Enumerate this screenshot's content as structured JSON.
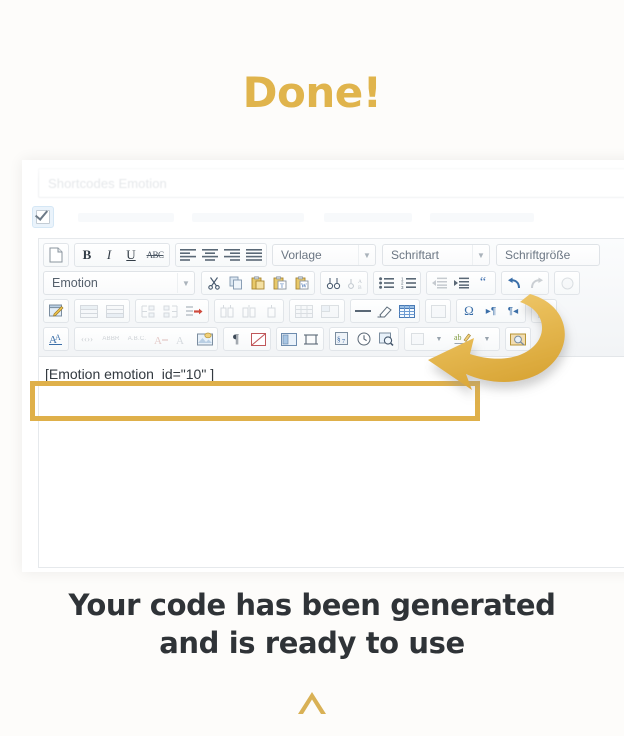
{
  "headline": "Done!",
  "colors": {
    "accent_gold": "#e0b44c",
    "highlight_box": "#dfb04a",
    "caption_text": "#2f3337",
    "page_background": "#fdfcfa"
  },
  "editor_panel": {
    "title_field": {
      "placeholder": "Shortcodes Emotion",
      "value": ""
    },
    "checkbox": {
      "checked": true,
      "label": ""
    },
    "toolbar": {
      "row1": {
        "buttons": [
          "new-document",
          "bold",
          "italic",
          "underline",
          "strikethrough",
          "align-left",
          "align-center",
          "align-right",
          "align-justify"
        ],
        "selects": [
          {
            "name": "template",
            "value": "Vorlage"
          },
          {
            "name": "font-family",
            "value": "Schriftart"
          },
          {
            "name": "font-size",
            "value": "Schriftgröße"
          }
        ]
      },
      "row2": {
        "select": {
          "name": "shortcode-style",
          "value": "Emotion"
        },
        "buttons": [
          "cut",
          "copy",
          "paste",
          "paste-as-text",
          "paste-from-word",
          "find",
          "find-and-replace",
          "bullet-list",
          "numbered-list",
          "outdent",
          "indent",
          "blockquote",
          "undo",
          "redo"
        ]
      },
      "row3": {
        "buttons": [
          "edit-html",
          "insert-row-before",
          "insert-row-after",
          "split-cell",
          "merge-cell",
          "delete-row",
          "insert-column-before",
          "insert-column-after",
          "delete-column",
          "table-row-properties",
          "table-cell-properties",
          "horizontal-rule",
          "remove-formatting",
          "toggle-guidelines",
          "special-character",
          "ltr",
          "rtl"
        ]
      },
      "row4": {
        "buttons": [
          "anchor",
          "quote-open",
          "abbr",
          "acronym",
          "subscript",
          "superscript",
          "insert-image",
          "show-invisibles",
          "page-break",
          "insert-layer",
          "horizontal-split",
          "citation",
          "insert-date",
          "insert-time",
          "preview",
          "spellcheck",
          "insert-media"
        ]
      }
    },
    "content": {
      "shortcode": "[Emotion emotion_id=\"10\" ]"
    },
    "annotation": {
      "arrow": "curved-down-left-arrow",
      "highlight_target": "shortcode"
    }
  },
  "caption": {
    "line1": "Your code has been generated",
    "line2": "and is ready to use"
  },
  "scroll_indicator": "chevron-up-icon"
}
